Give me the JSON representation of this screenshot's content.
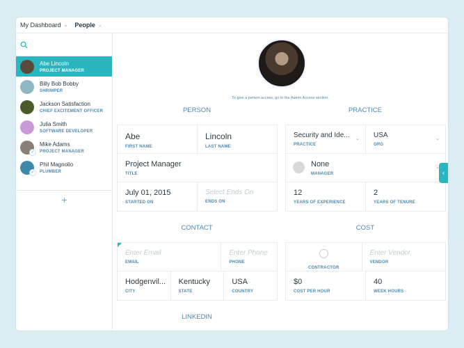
{
  "header": {
    "dashboard": "My Dashboard",
    "people": "People"
  },
  "people": [
    {
      "name": "Abe Lincoln",
      "role": "PROJECT MANAGER",
      "color": "#5a4a3e",
      "checked": false
    },
    {
      "name": "Billy Bob Bobby",
      "role": "SHRIMPER",
      "color": "#8fb7c4",
      "checked": false
    },
    {
      "name": "Jackson Satisfaction",
      "role": "CHIEF EXCITEMENT OFFICER",
      "color": "#4a5a2a",
      "checked": false
    },
    {
      "name": "Julia Smith",
      "role": "SOFTWARE DEVELOPER",
      "color": "#c99ad6",
      "checked": false
    },
    {
      "name": "Mike Adams",
      "role": "PROJECT MANAGER",
      "color": "#8a8078",
      "checked": true
    },
    {
      "name": "Phil Magnolio",
      "role": "PLUMBER",
      "color": "#3c8aa8",
      "checked": true
    }
  ],
  "add_label": "+",
  "note": "To give a person access, go to the Admin Access section.",
  "sections": {
    "person": "PERSON",
    "practice": "PRACTICE",
    "contact": "CONTACT",
    "cost": "COST",
    "linkedin": "LINKEDIN"
  },
  "person": {
    "first_name": "Abe",
    "first_name_label": "FIRST NAME",
    "last_name": "Lincoln",
    "last_name_label": "LAST NAME",
    "title": "Project Manager",
    "title_label": "TITLE",
    "started_on": "July 01, 2015",
    "started_on_label": "STARTED ON",
    "ends_on_placeholder": "Select Ends On",
    "ends_on_label": "ENDS ON"
  },
  "practice": {
    "practice": "Security and Ide...",
    "practice_label": "PRACTICE",
    "org": "USA",
    "org_label": "ORG",
    "manager": "None",
    "manager_label": "MANAGER",
    "experience": "12",
    "experience_label": "YEARS OF EXPERIENCE",
    "tenure": "2",
    "tenure_label": "YEARS OF TENURE"
  },
  "contact": {
    "email_placeholder": "Enter Email",
    "email_label": "EMAIL",
    "phone_placeholder": "Enter Phone",
    "phone_label": "PHONE",
    "city": "Hodgenvil...",
    "city_label": "CITY",
    "state": "Kentucky",
    "state_label": "STATE",
    "country": "USA",
    "country_label": "COUNTRY"
  },
  "cost": {
    "contractor_label": "CONTRACTOR",
    "vendor_placeholder": "Enter Vendor",
    "vendor_label": "VENDOR",
    "cost_per_hour": "$0",
    "cost_per_hour_label": "COST PER HOUR",
    "week_hours": "40",
    "week_hours_label": "WEEK HOURS"
  }
}
